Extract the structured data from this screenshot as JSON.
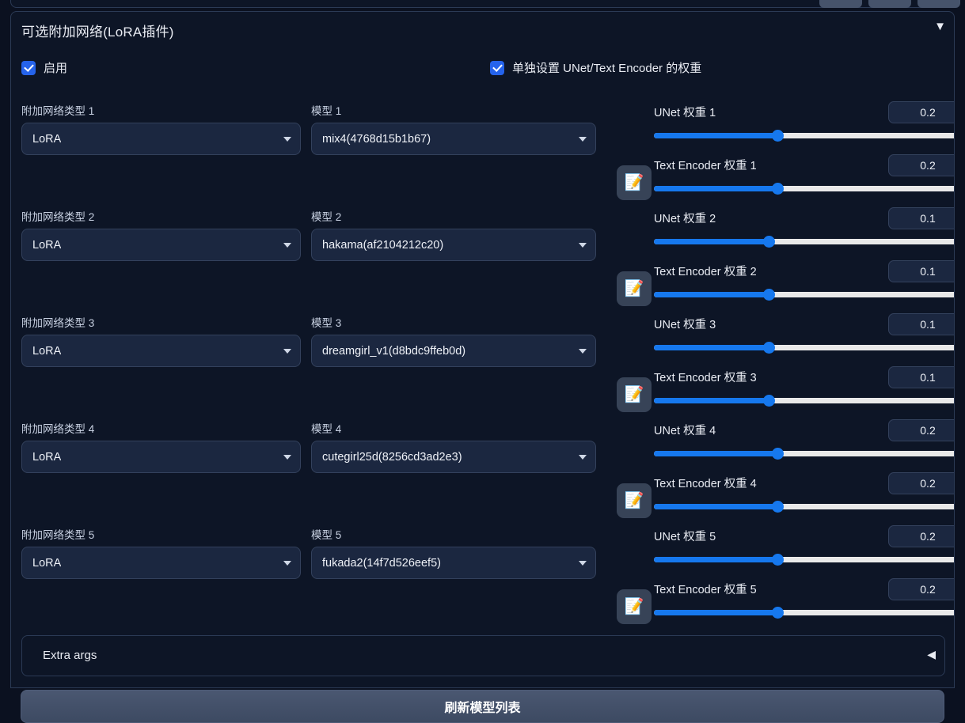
{
  "panel": {
    "title": "可选附加网络(LoRA插件)",
    "collapse_caret": "▼"
  },
  "checkboxes": {
    "enable_label": "启用",
    "enable_checked": true,
    "split_label": "单独设置 UNet/Text Encoder 的权重",
    "split_checked": true
  },
  "colors": {
    "accent": "#1678ee",
    "checkbox": "#2563eb",
    "panel_bg": "#0d1526",
    "page_bg": "#0b1120",
    "field_bg": "#1b2740",
    "border": "#2b3a55",
    "track": "#e9e9e9"
  },
  "rows": [
    {
      "type_label": "附加网络类型 1",
      "type_value": "LoRA",
      "model_label": "模型 1",
      "model_value": "mix4(4768d15b1b67)",
      "memo_icon": "memo-edit-icon",
      "unet_label": "UNet 权重 1",
      "unet_value": "0.2",
      "unet_pct": 41,
      "te_label": "Text Encoder 权重 1",
      "te_value": "0.2",
      "te_pct": 41
    },
    {
      "type_label": "附加网络类型 2",
      "type_value": "LoRA",
      "model_label": "模型 2",
      "model_value": "hakama(af2104212c20)",
      "memo_icon": "memo-edit-icon",
      "unet_label": "UNet 权重 2",
      "unet_value": "0.1",
      "unet_pct": 38,
      "te_label": "Text Encoder 权重 2",
      "te_value": "0.1",
      "te_pct": 38
    },
    {
      "type_label": "附加网络类型 3",
      "type_value": "LoRA",
      "model_label": "模型 3",
      "model_value": "dreamgirl_v1(d8bdc9ffeb0d)",
      "memo_icon": "memo-edit-icon",
      "unet_label": "UNet 权重 3",
      "unet_value": "0.1",
      "unet_pct": 38,
      "te_label": "Text Encoder 权重 3",
      "te_value": "0.1",
      "te_pct": 38
    },
    {
      "type_label": "附加网络类型 4",
      "type_value": "LoRA",
      "model_label": "模型 4",
      "model_value": "cutegirl25d(8256cd3ad2e3)",
      "memo_icon": "memo-edit-icon",
      "unet_label": "UNet 权重 4",
      "unet_value": "0.2",
      "unet_pct": 41,
      "te_label": "Text Encoder 权重 4",
      "te_value": "0.2",
      "te_pct": 41
    },
    {
      "type_label": "附加网络类型 5",
      "type_value": "LoRA",
      "model_label": "模型 5",
      "model_value": "fukada2(14f7d526eef5)",
      "memo_icon": "memo-edit-icon",
      "unet_label": "UNet 权重 5",
      "unet_value": "0.2",
      "unet_pct": 41,
      "te_label": "Text Encoder 权重 5",
      "te_value": "0.2",
      "te_pct": 41
    }
  ],
  "extra_args": {
    "label": "Extra args",
    "caret": "◀"
  },
  "refresh_button": {
    "label": "刷新模型列表"
  }
}
